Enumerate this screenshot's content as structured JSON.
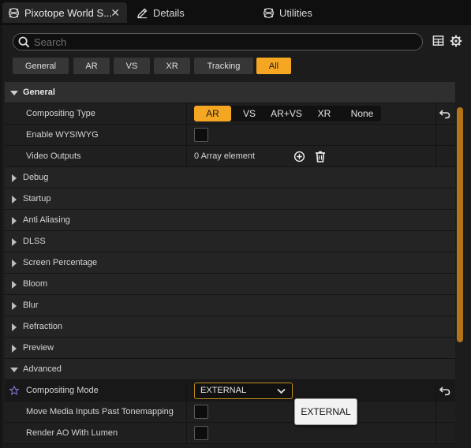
{
  "tabs": [
    {
      "label": "Pixotope World S...",
      "icon": "pixotope-icon",
      "active": true
    },
    {
      "label": "Details",
      "icon": "details-pen-icon",
      "active": false
    },
    {
      "label": "Utilities",
      "icon": "pixotope-icon",
      "active": false
    }
  ],
  "search": {
    "placeholder": "Search",
    "value": ""
  },
  "toolbar": {
    "icons": [
      "table-view-icon",
      "settings-gear-icon"
    ]
  },
  "filters": [
    "General",
    "AR",
    "VS",
    "XR",
    "Tracking",
    "All"
  ],
  "active_filter": "All",
  "tree": {
    "general": {
      "label": "General",
      "compositing_type": {
        "label": "Compositing Type",
        "options": [
          "AR",
          "VS",
          "AR+VS",
          "XR",
          "None"
        ],
        "selected": "AR"
      },
      "enable_wysiwyg": {
        "label": "Enable WYSIWYG",
        "checked": false
      },
      "video_outputs": {
        "label": "Video Outputs",
        "value": "0 Array element"
      }
    },
    "categories": [
      "Debug",
      "Startup",
      "Anti Aliasing",
      "DLSS",
      "Screen Percentage",
      "Bloom",
      "Blur",
      "Refraction",
      "Preview"
    ],
    "advanced": {
      "label": "Advanced",
      "compositing_mode": {
        "label": "Compositing Mode",
        "value": "EXTERNAL"
      },
      "move_media_inputs": {
        "label": "Move Media Inputs Past Tonemapping",
        "checked": false
      },
      "render_ao": {
        "label": "Render AO With Lumen",
        "checked": false
      }
    }
  },
  "dropdown": {
    "options": [
      "EXTERNAL"
    ]
  },
  "colors": {
    "accent": "#f5a623",
    "panel": "#1c1c1c",
    "favorite_star": "#8a6fd6"
  }
}
